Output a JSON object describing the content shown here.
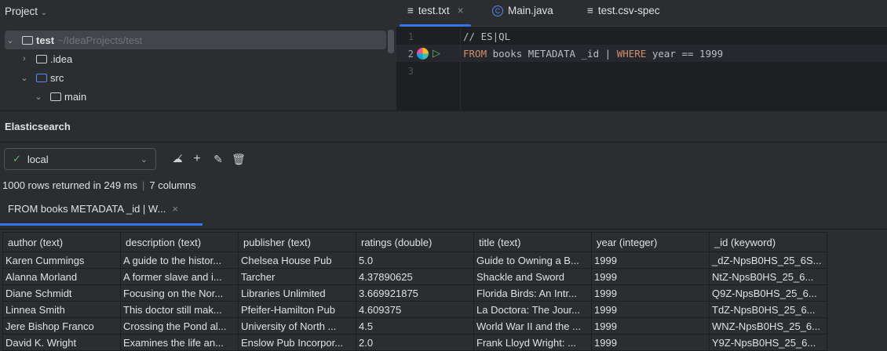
{
  "project": {
    "title": "Project",
    "root": "test",
    "root_path": "~/IdeaProjects/test",
    "items": [
      ".idea",
      "src",
      "main"
    ]
  },
  "editor": {
    "tabs": [
      "test.txt",
      "Main.java",
      "test.csv-spec"
    ],
    "lines": [
      "1",
      "2",
      "3"
    ],
    "code": {
      "comment": "// ES|QL",
      "kw1": "FROM",
      "t1": " books METADATA _id | ",
      "kw2": "WHERE",
      "t2": " year == 1999"
    }
  },
  "elasticsearch": {
    "title": "Elasticsearch",
    "connection": "local",
    "status": "1000 rows returned in 249 ms",
    "columns_count": "7 columns",
    "result_tab": "FROM books METADATA _id | W..."
  },
  "table": {
    "headers": [
      "author (text)",
      "description (text)",
      "publisher (text)",
      "ratings (double)",
      "title (text)",
      "year (integer)",
      "_id (keyword)"
    ],
    "rows": [
      [
        "Karen Cummings",
        "A guide to the histor...",
        "Chelsea House Pub",
        "5.0",
        "Guide to Owning a B...",
        "1999",
        "_dZ-NpsB0HS_25_6S..."
      ],
      [
        "Alanna Morland",
        "A former slave and i...",
        "Tarcher",
        "4.37890625",
        "Shackle and Sword",
        "1999",
        "NtZ-NpsB0HS_25_6..."
      ],
      [
        "Diane Schmidt",
        "Focusing on the Nor...",
        "Libraries Unlimited",
        "3.669921875",
        "Florida Birds: An Intr...",
        "1999",
        "Q9Z-NpsB0HS_25_6..."
      ],
      [
        "Linnea Smith",
        "This doctor still mak...",
        "Pfeifer-Hamilton Pub",
        "4.609375",
        "La Doctora: The Jour...",
        "1999",
        "TdZ-NpsB0HS_25_6..."
      ],
      [
        "Jere Bishop Franco",
        "Crossing the Pond al...",
        "University of North ...",
        "4.5",
        "World War II and the ...",
        "1999",
        "WNZ-NpsB0HS_25_6..."
      ],
      [
        "David K. Wright",
        "Examines the life an...",
        "Enslow Pub Incorpor...",
        "2.0",
        "Frank Lloyd Wright: ...",
        "1999",
        "Y9Z-NpsB0HS_25_6..."
      ]
    ]
  }
}
